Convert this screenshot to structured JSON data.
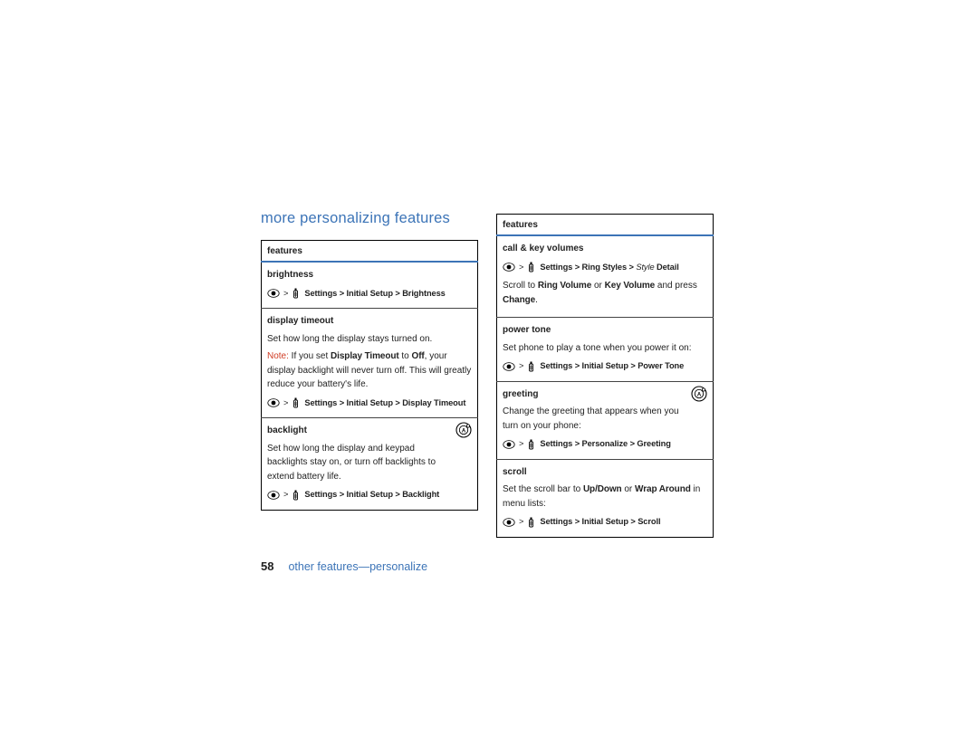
{
  "section_title": "more personalizing features",
  "left": {
    "header": "features",
    "rows": [
      {
        "name": "brightness",
        "path_label": "Settings > Initial Setup > Brightness"
      },
      {
        "name": "display timeout",
        "desc": "Set how long the display stays turned on.",
        "note_label": "Note:",
        "note_pre": " If you set ",
        "note_bold": "Display Timeout",
        "note_mid": " to ",
        "note_bold2": "Off",
        "note_post": ", your display backlight will never turn off. This will greatly reduce your battery's life.",
        "path_label": "Settings > Initial Setup > Display Timeout"
      },
      {
        "name": "backlight",
        "desc": "Set how long the display and keypad backlights stay on, or turn off backlights to extend battery life.",
        "path_label": "Settings > Initial Setup > Backlight",
        "badge": true
      }
    ]
  },
  "right": {
    "header": "features",
    "rows": [
      {
        "name": "call & key volumes",
        "path_pre": "Settings > Ring Styles > ",
        "path_italic": "Style",
        "path_post": " Detail",
        "desc_pre": "Scroll to ",
        "desc_b1": "Ring Volume",
        "desc_mid": " or ",
        "desc_b2": "Key Volume",
        "desc_mid2": " and press ",
        "desc_b3": "Change",
        "desc_end": "."
      },
      {
        "name": "power tone",
        "desc": "Set phone to play a tone when you power it on:",
        "path_label": "Settings > Initial Setup > Power Tone"
      },
      {
        "name": "greeting",
        "desc": "Change the greeting that appears when you turn on your phone:",
        "path_label": "Settings > Personalize > Greeting",
        "badge": true
      },
      {
        "name": "scroll",
        "desc_pre": "Set the scroll bar to ",
        "desc_b1": "Up/Down",
        "desc_mid": " or ",
        "desc_b2": "Wrap Around",
        "desc_mid2": " in menu lists:",
        "path_label": "Settings > Initial Setup > Scroll"
      }
    ]
  },
  "footer": {
    "page": "58",
    "title": "other features—personalize"
  }
}
